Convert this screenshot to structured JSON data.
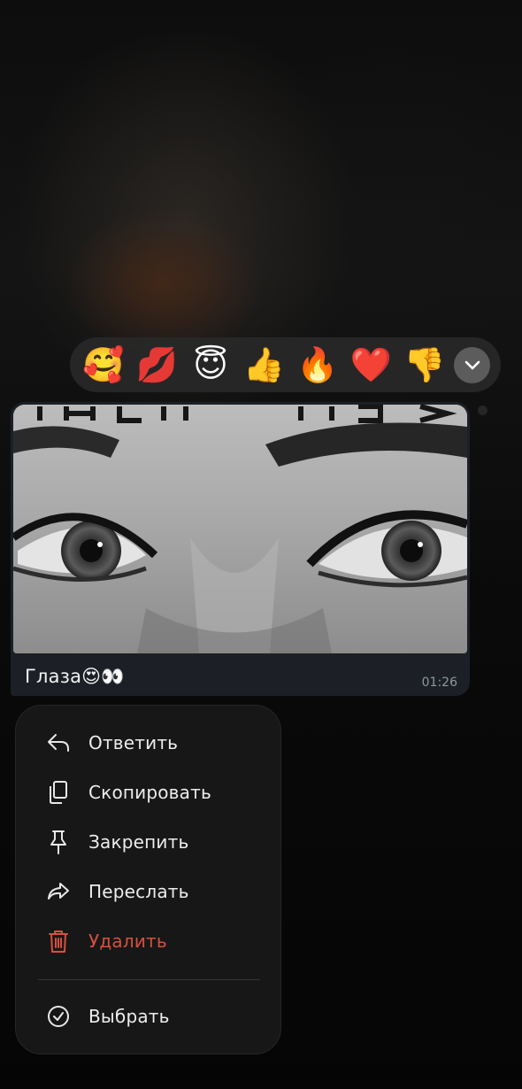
{
  "reactions": [
    {
      "emoji": "🥰",
      "name": "smiling-face-with-hearts"
    },
    {
      "emoji": "💋",
      "name": "kiss-mark"
    },
    {
      "emoji": "😇",
      "name": "smiling-face-with-halo"
    },
    {
      "emoji": "👍",
      "name": "thumbs-up"
    },
    {
      "emoji": "🔥",
      "name": "fire"
    },
    {
      "emoji": "❤️",
      "name": "red-heart"
    },
    {
      "emoji": "👎",
      "name": "thumbs-down"
    }
  ],
  "message": {
    "caption": "Глаза😍👀",
    "time": "01:26"
  },
  "menu": {
    "reply": "Ответить",
    "copy": "Скопировать",
    "pin": "Закрепить",
    "forward": "Переслать",
    "delete": "Удалить",
    "select": "Выбрать"
  },
  "colors": {
    "danger": "#d6503f",
    "bubble": "#1c2026",
    "menu_background": "#181818"
  },
  "icons": [
    "chevron-down-icon",
    "reply-arrow-icon",
    "copy-icon",
    "pin-icon",
    "forward-arrow-icon",
    "trash-icon",
    "check-circle-icon"
  ]
}
